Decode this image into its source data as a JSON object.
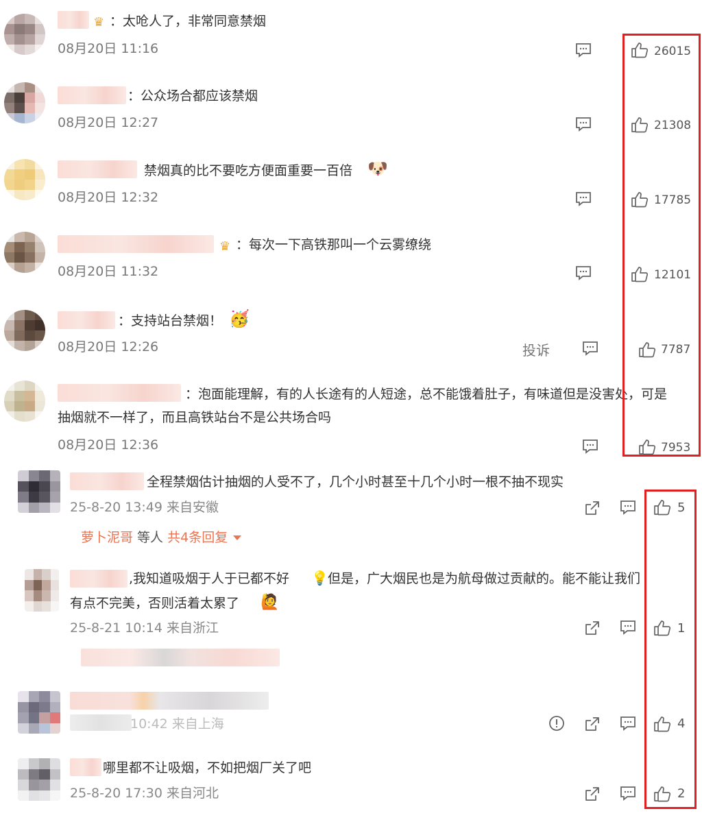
{
  "comments": [
    {
      "text": "：太呛人了，非常同意禁烟",
      "time": "08月20日 11:16",
      "likes": "26015"
    },
    {
      "text": "：公众场合都应该禁烟",
      "time": "08月20日 12:27",
      "likes": "21308"
    },
    {
      "text": "禁烟真的比不要吃方便面重要一百倍",
      "time": "08月20日 12:32",
      "likes": "17785"
    },
    {
      "text": "：每次一下高铁那叫一个云雾缭绕",
      "time": "08月20日 11:32",
      "likes": "12101"
    },
    {
      "text": "：支持站台禁烟！",
      "time": "08月20日 12:26",
      "likes": "7787",
      "complain": "投诉"
    },
    {
      "text_line1": "：泡面能理解，有的人长途有的人短途，总不能饿着肚子，有味道但是没害处，可是",
      "text_line2": "抽烟就不一样了，而且高铁站台不是公共场合吗",
      "time": "08月20日 12:36",
      "likes": "7953"
    }
  ],
  "replies": [
    {
      "text": "全程禁烟估计抽烟的人受不了，几个小时甚至十几个小时一根不抽不现实",
      "time": "25-8-20 13:49 来自安徽",
      "likes": "5"
    },
    {
      "text_line1": ",我知道吸烟于人于已都不好",
      "text_line1b": "但是，广大烟民也是为航母做过贡献的。能不能让我们",
      "text_line2": "有点不完美，否则活着太累了",
      "time": "25-8-21 10:14 来自浙江",
      "likes": "1"
    },
    {
      "time": "10:42 来自上海",
      "likes": "4"
    },
    {
      "text": "哪里都不让吸烟，不如把烟厂关了吧",
      "time": "25-8-20 17:30 来自河北",
      "likes": "2"
    }
  ],
  "sub_reply": {
    "name": "萝卜泥哥",
    "middle": " 等人 ",
    "count": "共4条回复"
  },
  "icons": {
    "comment": "comment-icon",
    "like": "thumbs-up-icon",
    "share": "share-icon",
    "report": "report-icon",
    "crown": "crown-icon"
  },
  "colors": {
    "highlight": "#e02020",
    "link": "#eb7350"
  }
}
